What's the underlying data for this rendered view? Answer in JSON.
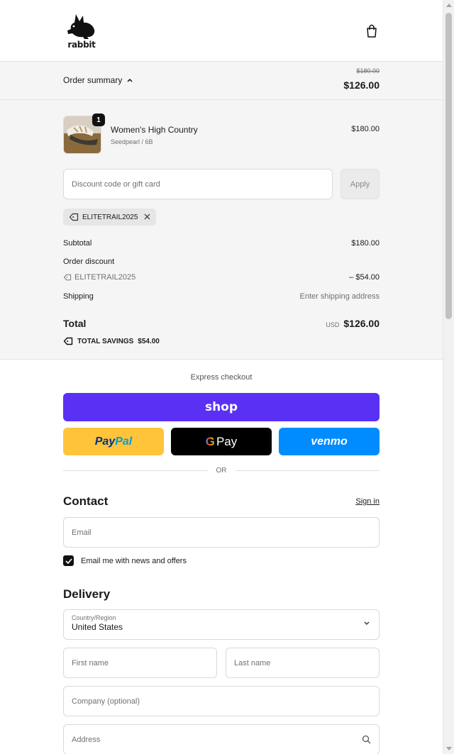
{
  "brand": {
    "name": "rabbit"
  },
  "summary": {
    "toggle_label": "Order summary",
    "original_total": "$180.00",
    "total": "$126.00"
  },
  "product": {
    "name": "Women's High Country",
    "variant": "Seedpearl / 6B",
    "price": "$180.00",
    "quantity": "1"
  },
  "discount": {
    "placeholder": "Discount code or gift card",
    "apply_label": "Apply",
    "applied_code": "ELITETRAIL2025"
  },
  "totals": {
    "subtotal_label": "Subtotal",
    "subtotal_value": "$180.00",
    "order_discount_label": "Order discount",
    "discount_code": "ELITETRAIL2025",
    "discount_value": "– $54.00",
    "shipping_label": "Shipping",
    "shipping_value": "Enter shipping address",
    "total_label": "Total",
    "currency": "USD",
    "total_value": "$126.00",
    "savings_label": "TOTAL SAVINGS",
    "savings_value": "$54.00"
  },
  "express": {
    "label": "Express checkout",
    "shop_label": "shop",
    "paypal_part1": "Pay",
    "paypal_part2": "Pal",
    "gpay_g": "G",
    "gpay_label": "Pay",
    "venmo_label": "venmo",
    "divider_label": "OR"
  },
  "contact": {
    "title": "Contact",
    "signin_label": "Sign in",
    "email_placeholder": "Email",
    "newsletter_label": "Email me with news and offers",
    "newsletter_checked": true
  },
  "delivery": {
    "title": "Delivery",
    "country_label": "Country/Region",
    "country_value": "United States",
    "first_name_placeholder": "First name",
    "last_name_placeholder": "Last name",
    "company_placeholder": "Company (optional)",
    "address_placeholder": "Address"
  }
}
